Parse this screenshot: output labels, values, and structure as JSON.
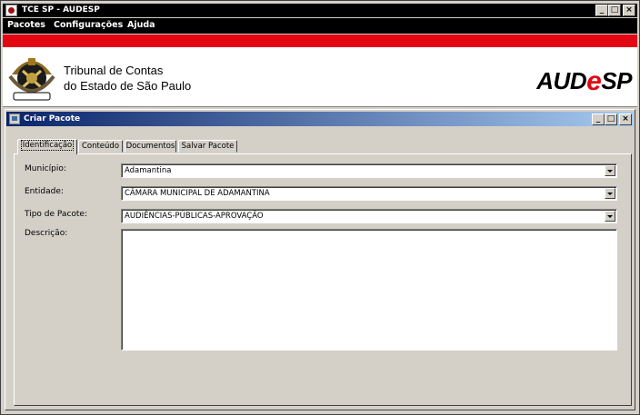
{
  "app": {
    "title": "TCE SP - AUDESP",
    "window_buttons": {
      "minimize": "_",
      "maximize": "□",
      "close": "×"
    }
  },
  "menu": {
    "items": [
      {
        "label": "Pacotes"
      },
      {
        "label": "Configurações"
      },
      {
        "label": "Ajuda"
      }
    ]
  },
  "banner": {
    "org_line1": "Tribunal de Contas",
    "org_line2": "do Estado de São Paulo",
    "logo_prefix": "AUD",
    "logo_e": "e",
    "logo_suffix": "SP",
    "accent_color": "#e30613"
  },
  "dialog": {
    "title": "Criar Pacote",
    "tabs": [
      {
        "label": "Identificação",
        "active": true
      },
      {
        "label": "Conteúdo",
        "active": false
      },
      {
        "label": "Documentos",
        "active": false
      },
      {
        "label": "Salvar Pacote",
        "active": false
      }
    ],
    "fields": {
      "municipio": {
        "label": "Município:",
        "value": "Adamantina"
      },
      "entidade": {
        "label": "Entidade:",
        "value": "CÂMARA MUNICIPAL DE ADAMANTINA"
      },
      "tipo": {
        "label": "Tipo de Pacote:",
        "value": "AUDIÊNCIAS-PÚBLICAS-APROVAÇÃO"
      },
      "descricao": {
        "label": "Descrição:",
        "value": ""
      }
    }
  }
}
